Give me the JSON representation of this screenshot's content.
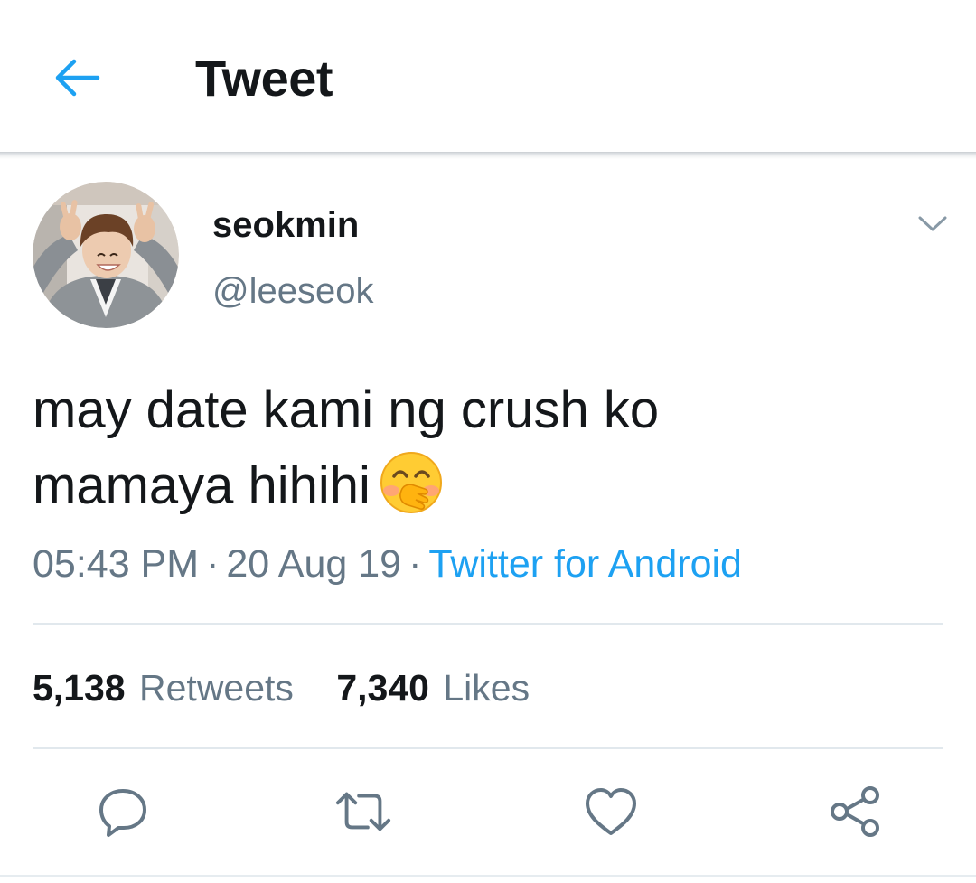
{
  "appbar": {
    "title": "Tweet",
    "back_icon": "arrow-left-icon",
    "accent_color": "#1da1f2"
  },
  "tweet": {
    "author": {
      "display_name": "seokmin",
      "handle": "@leeseok",
      "avatar_icon": "profile-photo"
    },
    "menu_icon": "chevron-down-icon",
    "text_lines": [
      "may date kami ng crush ko",
      "mamaya hihihi"
    ],
    "emoji": "face-with-hand-over-mouth",
    "time": "05:43 PM",
    "separator": "·",
    "date": "20 Aug 19",
    "source": "Twitter for Android",
    "stats": {
      "retweets_count": "5,138",
      "retweets_label": "Retweets",
      "likes_count": "7,340",
      "likes_label": "Likes"
    }
  },
  "actions": [
    {
      "name": "reply",
      "icon": "reply-icon"
    },
    {
      "name": "retweet",
      "icon": "retweet-icon"
    },
    {
      "name": "like",
      "icon": "heart-icon"
    },
    {
      "name": "share",
      "icon": "share-icon"
    }
  ],
  "colors": {
    "text_primary": "#14171a",
    "text_secondary": "#657786",
    "link": "#1da1f2",
    "divider": "#e1e8ed",
    "icon_gray": "#657786"
  }
}
